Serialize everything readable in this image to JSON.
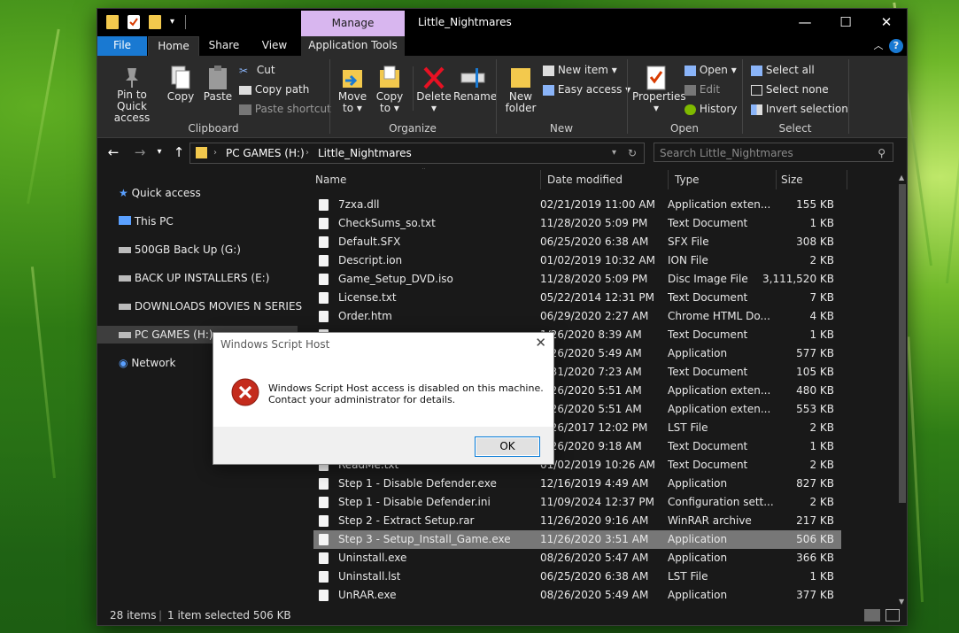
{
  "window": {
    "title": "Little_Nightmares",
    "manage_tab": "Manage",
    "minimize": "—",
    "maximize": "☐",
    "close": "✕"
  },
  "ribbon_tabs": [
    "File",
    "Home",
    "Share",
    "View",
    "Application Tools"
  ],
  "ribbon": {
    "clipboard": {
      "pin": "Pin to Quick access",
      "copy": "Copy",
      "paste": "Paste",
      "cut": "Cut",
      "copy_path": "Copy path",
      "paste_shortcut": "Paste shortcut",
      "label": "Clipboard"
    },
    "organize": {
      "move_to": "Move to",
      "copy_to": "Copy to",
      "delete": "Delete",
      "rename": "Rename",
      "label": "Organize"
    },
    "new": {
      "new_folder": "New folder",
      "new_item": "New item",
      "easy_access": "Easy access",
      "label": "New"
    },
    "open": {
      "properties": "Properties",
      "open": "Open",
      "edit": "Edit",
      "history": "History",
      "label": "Open"
    },
    "select": {
      "select_all": "Select all",
      "select_none": "Select none",
      "invert": "Invert selection",
      "label": "Select"
    }
  },
  "address": {
    "crumbs": [
      "PC GAMES (H:)",
      "Little_Nightmares"
    ],
    "search_placeholder": "Search Little_Nightmares"
  },
  "nav": [
    {
      "label": "Quick access",
      "icon": "star-icon"
    },
    {
      "label": "This PC",
      "icon": "monitor-icon"
    },
    {
      "label": "500GB Back Up (G:)",
      "icon": "drive-icon"
    },
    {
      "label": "BACK UP INSTALLERS (E:)",
      "icon": "drive-icon"
    },
    {
      "label": "DOWNLOADS MOVIES N SERIES (F",
      "icon": "drive-icon"
    },
    {
      "label": "PC GAMES (H:)",
      "icon": "drive-icon",
      "selected": true
    },
    {
      "label": "Network",
      "icon": "network-icon"
    }
  ],
  "columns": {
    "name": "Name",
    "date": "Date modified",
    "type": "Type",
    "size": "Size"
  },
  "files": [
    {
      "name": "7zxa.dll",
      "date": "02/21/2019 11:00 AM",
      "type": "Application exten...",
      "size": "155 KB"
    },
    {
      "name": "CheckSums_so.txt",
      "date": "11/28/2020 5:09 PM",
      "type": "Text Document",
      "size": "1 KB"
    },
    {
      "name": "Default.SFX",
      "date": "06/25/2020 6:38 AM",
      "type": "SFX File",
      "size": "308 KB"
    },
    {
      "name": "Descript.ion",
      "date": "01/02/2019 10:32 AM",
      "type": "ION File",
      "size": "2 KB"
    },
    {
      "name": "Game_Setup_DVD.iso",
      "date": "11/28/2020 5:09 PM",
      "type": "Disc Image File",
      "size": "3,111,520 KB"
    },
    {
      "name": "License.txt",
      "date": "05/22/2014 12:31 PM",
      "type": "Text Document",
      "size": "7 KB"
    },
    {
      "name": "Order.htm",
      "date": "06/29/2020 2:27 AM",
      "type": "Chrome HTML Do...",
      "size": "4 KB"
    },
    {
      "name": "",
      "date": "1/26/2020 8:39 AM",
      "type": "Text Document",
      "size": "1 KB"
    },
    {
      "name": "",
      "date": "8/26/2020 5:49 AM",
      "type": "Application",
      "size": "577 KB"
    },
    {
      "name": "",
      "date": "5/31/2020 7:23 AM",
      "type": "Text Document",
      "size": "105 KB"
    },
    {
      "name": "",
      "date": "8/26/2020 5:51 AM",
      "type": "Application exten...",
      "size": "480 KB"
    },
    {
      "name": "",
      "date": "8/26/2020 5:51 AM",
      "type": "Application exten...",
      "size": "553 KB"
    },
    {
      "name": "",
      "date": "1/26/2017 12:02 PM",
      "type": "LST File",
      "size": "2 KB"
    },
    {
      "name": "",
      "date": "1/26/2020 9:18 AM",
      "type": "Text Document",
      "size": "1 KB"
    },
    {
      "name": "ReadMe.txt",
      "date": "01/02/2019 10:26 AM",
      "type": "Text Document",
      "size": "2 KB"
    },
    {
      "name": "Step 1 - Disable Defender.exe",
      "date": "12/16/2019 4:49 AM",
      "type": "Application",
      "size": "827 KB"
    },
    {
      "name": "Step 1 - Disable Defender.ini",
      "date": "11/09/2024 12:37 PM",
      "type": "Configuration sett...",
      "size": "2 KB"
    },
    {
      "name": "Step 2 - Extract Setup.rar",
      "date": "11/26/2020 9:16 AM",
      "type": "WinRAR archive",
      "size": "217 KB"
    },
    {
      "name": "Step 3 - Setup_Install_Game.exe",
      "date": "11/26/2020 3:51 AM",
      "type": "Application",
      "size": "506 KB",
      "selected": true
    },
    {
      "name": "Uninstall.exe",
      "date": "08/26/2020 5:47 AM",
      "type": "Application",
      "size": "366 KB"
    },
    {
      "name": "Uninstall.lst",
      "date": "06/25/2020 6:38 AM",
      "type": "LST File",
      "size": "1 KB"
    },
    {
      "name": "UnRAR.exe",
      "date": "08/26/2020 5:49 AM",
      "type": "Application",
      "size": "377 KB"
    }
  ],
  "status": {
    "items": "28 items",
    "selected": "1 item selected  506 KB"
  },
  "dialog": {
    "title": "Windows Script Host",
    "line1": "Windows Script Host access is disabled on this machine.",
    "line2": "Contact your administrator for details.",
    "ok": "OK",
    "icon": "error-icon"
  },
  "colors": {
    "accent": "#1979d2",
    "manage": "#d8b6ef",
    "error": "#c42b1c",
    "folder": "#f3c94d"
  }
}
